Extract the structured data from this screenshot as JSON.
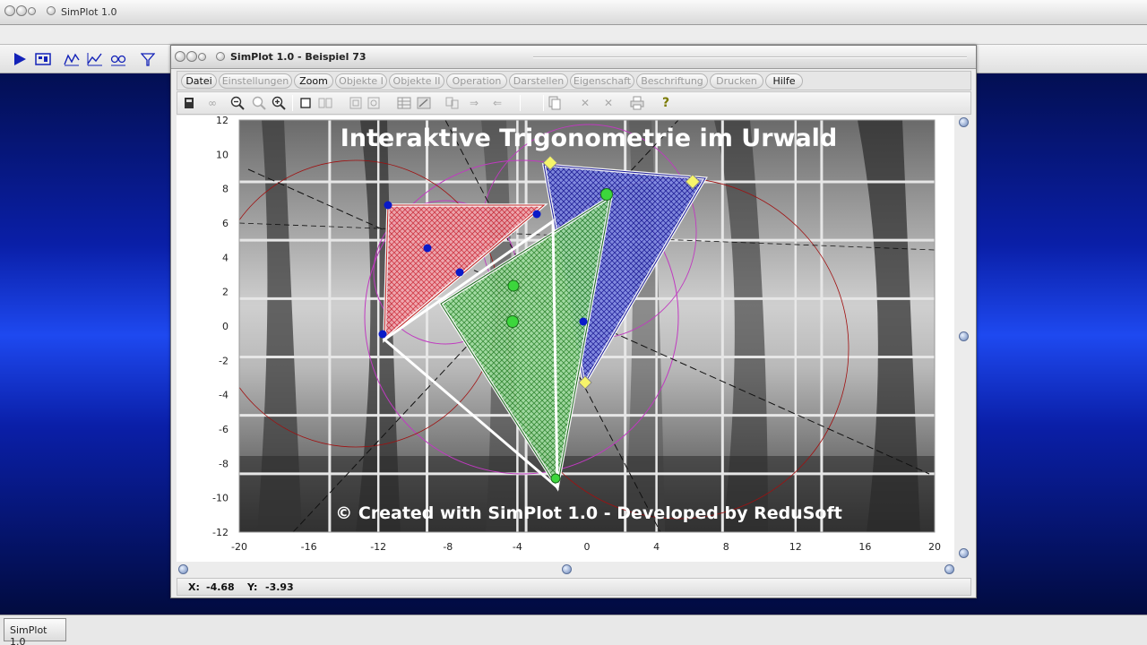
{
  "app": {
    "title": "SimPlot 1.0"
  },
  "child_window": {
    "title": "SimPlot 1.0 - Beispiel 73"
  },
  "menu": [
    {
      "label": "Datei",
      "enabled": true
    },
    {
      "label": "Einstellungen",
      "enabled": false
    },
    {
      "label": "Zoom",
      "enabled": true
    },
    {
      "label": "Objekte I",
      "enabled": false
    },
    {
      "label": "Objekte II",
      "enabled": false
    },
    {
      "label": "Operation",
      "enabled": false
    },
    {
      "label": "Darstellen",
      "enabled": false
    },
    {
      "label": "Eigenschaft",
      "enabled": false
    },
    {
      "label": "Beschriftung",
      "enabled": false
    },
    {
      "label": "Drucken",
      "enabled": false
    },
    {
      "label": "Hilfe",
      "enabled": true
    }
  ],
  "toolbar_icons": [
    "calculator-icon",
    "glasses-icon",
    "zoom-out-icon",
    "zoom-normal-icon",
    "zoom-in-icon",
    "square-icon",
    "double-square-icon",
    "frame-icon",
    "frame-alt-icon",
    "table-icon",
    "table-edit-icon",
    "copy-object-icon",
    "arrow-right-icon",
    "arrow-left-icon",
    "pages-icon",
    "cross-icon",
    "cross-alt-icon",
    "print-icon",
    "help-icon"
  ],
  "main_toolbar_icons": [
    "play-icon",
    "display-icon",
    "graph-icon",
    "graph-alt-icon",
    "graph-multi-icon",
    "funnel-icon"
  ],
  "plot": {
    "title": "Interaktive Trigonometrie im Urwald",
    "footer": "© Created with SimPlot 1.0 - Developed by ReduSoft",
    "xlim": [
      -20,
      20
    ],
    "ylim": [
      -12,
      12
    ],
    "x_ticks": [
      "-20",
      "-16",
      "-12",
      "-8",
      "-4",
      "0",
      "4",
      "8",
      "12",
      "16",
      "20"
    ],
    "y_ticks": [
      "12",
      "10",
      "8",
      "6",
      "4",
      "2",
      "0",
      "-2",
      "-4",
      "-6",
      "-8",
      "-10",
      "-12"
    ],
    "colors": {
      "red": "#e0303c",
      "green": "#3cd63c",
      "blue": "#3030d0",
      "yellow": "#f6f46a",
      "point_blue": "#0a1ac8"
    }
  },
  "status": {
    "x_label": "X:",
    "x_value": "-4.68",
    "y_label": "Y:",
    "y_value": "-3.93"
  },
  "taskbar": {
    "item": "SimPlot 1.0"
  }
}
